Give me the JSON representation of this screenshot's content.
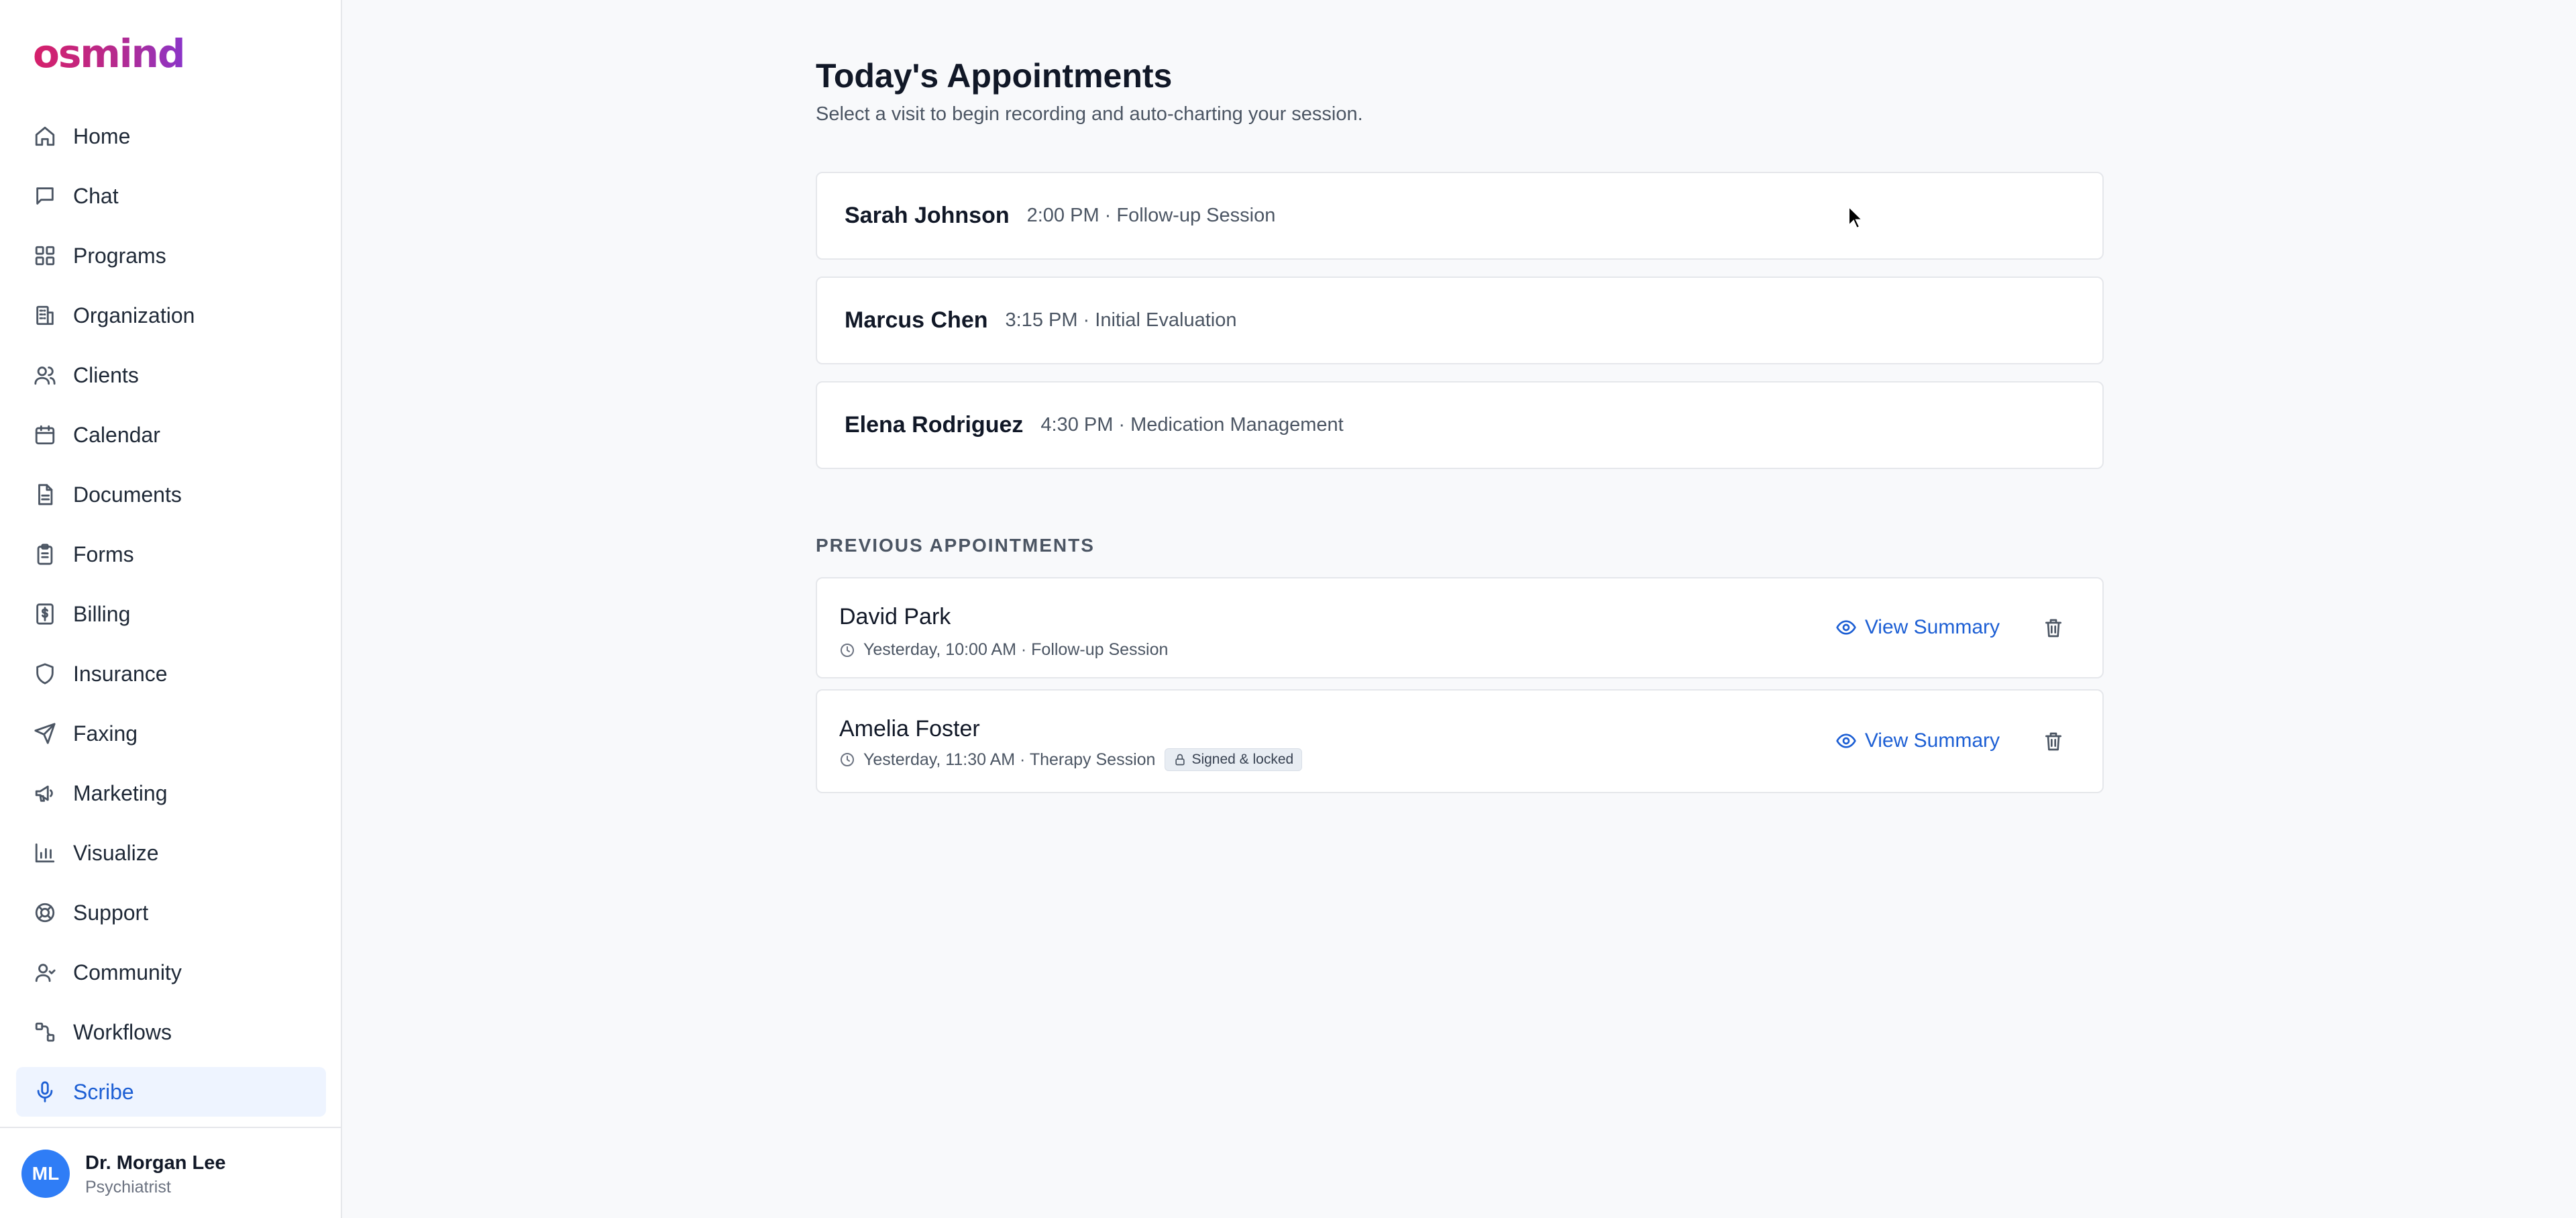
{
  "brand": {
    "logo_text": "osmind",
    "gradient_colors": [
      "#d6206a",
      "#8a35c9"
    ]
  },
  "sidebar": {
    "items": [
      {
        "label": "Home",
        "icon": "home-icon",
        "active": false
      },
      {
        "label": "Chat",
        "icon": "chat-icon",
        "active": false
      },
      {
        "label": "Programs",
        "icon": "grid-icon",
        "active": false
      },
      {
        "label": "Organization",
        "icon": "building-icon",
        "active": false
      },
      {
        "label": "Clients",
        "icon": "users-icon",
        "active": false
      },
      {
        "label": "Calendar",
        "icon": "calendar-icon",
        "active": false
      },
      {
        "label": "Documents",
        "icon": "document-icon",
        "active": false
      },
      {
        "label": "Forms",
        "icon": "clipboard-icon",
        "active": false
      },
      {
        "label": "Billing",
        "icon": "dollar-receipt-icon",
        "active": false
      },
      {
        "label": "Insurance",
        "icon": "shield-icon",
        "active": false
      },
      {
        "label": "Faxing",
        "icon": "send-icon",
        "active": false
      },
      {
        "label": "Marketing",
        "icon": "megaphone-icon",
        "active": false
      },
      {
        "label": "Visualize",
        "icon": "bar-chart-icon",
        "active": false
      },
      {
        "label": "Support",
        "icon": "lifebuoy-icon",
        "active": false
      },
      {
        "label": "Community",
        "icon": "user-icon",
        "active": false
      },
      {
        "label": "Workflows",
        "icon": "workflow-icon",
        "active": false
      },
      {
        "label": "Scribe",
        "icon": "microphone-icon",
        "active": true
      }
    ],
    "user": {
      "initials": "ML",
      "name": "Dr. Morgan Lee",
      "role": "Psychiatrist",
      "avatar_color": "#2f7df6"
    }
  },
  "main": {
    "title": "Today's Appointments",
    "subtitle": "Select a visit to begin recording and auto-charting your session.",
    "today": [
      {
        "name": "Sarah Johnson",
        "meta": "2:00 PM · Follow-up Session"
      },
      {
        "name": "Marcus Chen",
        "meta": "3:15 PM · Initial Evaluation"
      },
      {
        "name": "Elena Rodriguez",
        "meta": "4:30 PM · Medication Management"
      }
    ],
    "previous_label": "PREVIOUS APPOINTMENTS",
    "previous": [
      {
        "name": "David Park",
        "meta": "Yesterday, 10:00 AM · Follow-up Session",
        "badge": "",
        "action": "View Summary"
      },
      {
        "name": "Amelia Foster",
        "meta": "Yesterday, 11:30 AM · Therapy Session",
        "badge": "Signed & locked",
        "action": "View Summary"
      }
    ]
  },
  "colors": {
    "accent": "#1d5fd4",
    "active_bg": "#eef4ff",
    "background": "#f8f9fb"
  }
}
